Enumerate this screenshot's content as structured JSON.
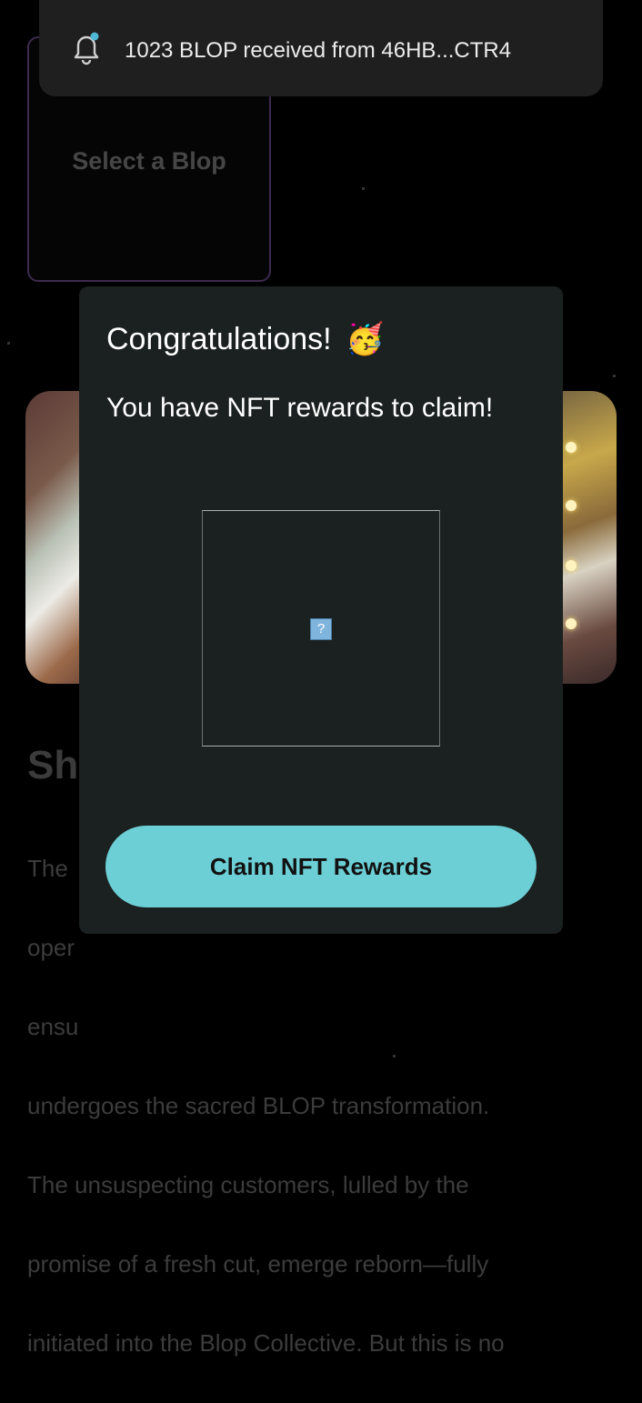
{
  "notification": {
    "message": "1023 BLOP received from 46HB...CTR4",
    "top_fragment": "··· ···",
    "icon": "bell-icon",
    "badge_color": "#4fb8d4"
  },
  "background": {
    "select_card_label": "Select a Blop",
    "article_title": "Sh",
    "article_lines": [
      "The",
      "oper",
      "ensu",
      "undergoes the sacred BLOP transformation.",
      "The unsuspecting customers, lulled by the",
      "promise of a fresh cut, emerge reborn—fully",
      "initiated into the Blop Collective. But this is no"
    ]
  },
  "modal": {
    "title": "Congratulations!",
    "title_emoji": "🥳",
    "subtitle": "You have NFT rewards to claim!",
    "nft_placeholder": "?",
    "claim_button": "Claim NFT Rewards",
    "accent_color": "#6ccfd5"
  }
}
